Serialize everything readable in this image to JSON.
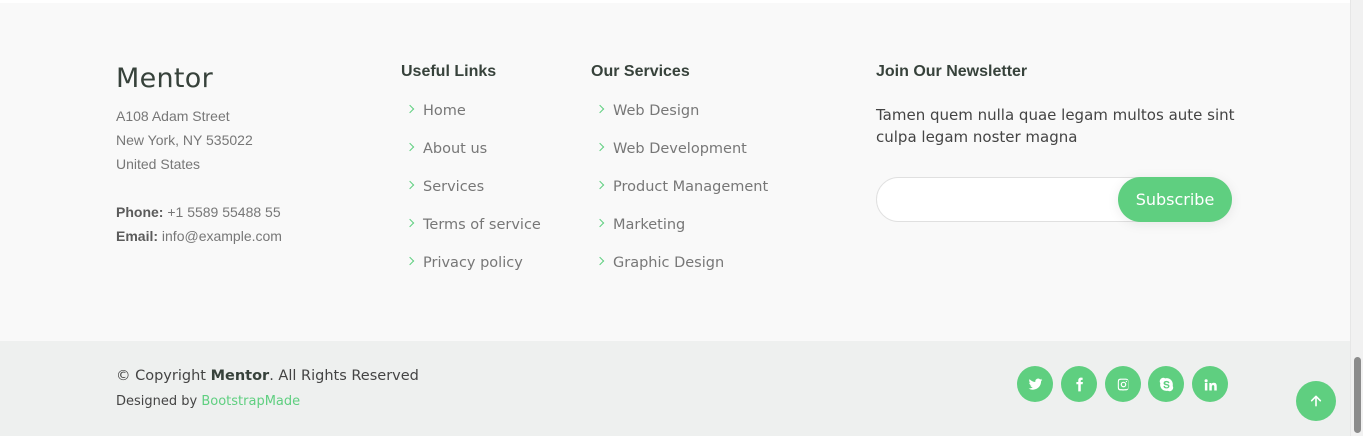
{
  "brand": {
    "name": "Mentor",
    "address": [
      "A108 Adam Street",
      "New York, NY 535022",
      "United States"
    ],
    "phone_label": "Phone:",
    "phone": "+1 5589 55488 55",
    "email_label": "Email:",
    "email": "info@example.com"
  },
  "useful_links": {
    "title": "Useful Links",
    "items": [
      "Home",
      "About us",
      "Services",
      "Terms of service",
      "Privacy policy"
    ]
  },
  "services": {
    "title": "Our Services",
    "items": [
      "Web Design",
      "Web Development",
      "Product Management",
      "Marketing",
      "Graphic Design"
    ]
  },
  "newsletter": {
    "title": "Join Our Newsletter",
    "text": "Tamen quem nulla quae legam multos aute sint culpa legam noster magna",
    "input_value": "",
    "button_label": "Subscribe"
  },
  "bottom": {
    "copyright_prefix": "© Copyright ",
    "copyright_brand": "Mentor",
    "copyright_suffix": ". All Rights Reserved",
    "designed_prefix": "Designed by ",
    "designed_link": "BootstrapMade"
  },
  "social": [
    "twitter-icon",
    "facebook-icon",
    "instagram-icon",
    "skype-icon",
    "linkedin-icon"
  ],
  "colors": {
    "accent": "#5fcf80",
    "footer_top_bg": "#f9f9f9",
    "footer_bottom_bg": "#eef0ef",
    "heading": "#37423b",
    "text_muted": "#777777"
  }
}
